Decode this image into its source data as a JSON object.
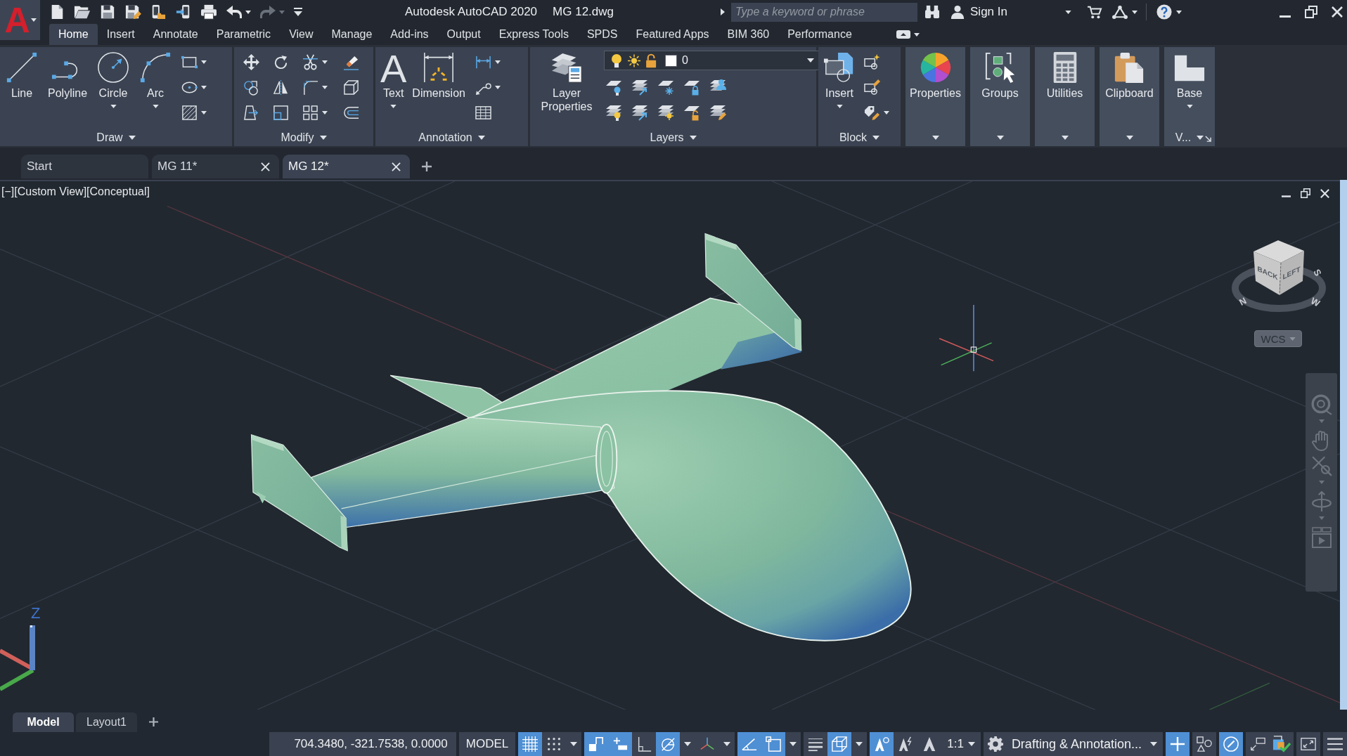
{
  "app_button": {
    "label": "A"
  },
  "quick_access": {
    "redo_disabled": true
  },
  "title": {
    "app": "Autodesk AutoCAD 2020",
    "file": "MG 12.dwg"
  },
  "search": {
    "placeholder": "Type a keyword or phrase"
  },
  "account": {
    "label": "Sign In"
  },
  "ribbon_tabs": [
    {
      "label": "Home",
      "selected": true
    },
    {
      "label": "Insert",
      "selected": false
    },
    {
      "label": "Annotate",
      "selected": false
    },
    {
      "label": "Parametric",
      "selected": false
    },
    {
      "label": "View",
      "selected": false
    },
    {
      "label": "Manage",
      "selected": false
    },
    {
      "label": "Add-ins",
      "selected": false
    },
    {
      "label": "Output",
      "selected": false
    },
    {
      "label": "Express Tools",
      "selected": false
    },
    {
      "label": "SPDS",
      "selected": false
    },
    {
      "label": "Featured Apps",
      "selected": false
    },
    {
      "label": "BIM 360",
      "selected": false
    },
    {
      "label": "Performance",
      "selected": false
    }
  ],
  "ribbon_panels": [
    {
      "kind": "draw",
      "title": "Draw",
      "buttons": [
        {
          "label": "Line"
        },
        {
          "label": "Polyline"
        },
        {
          "label": "Circle"
        },
        {
          "label": "Arc"
        }
      ]
    },
    {
      "kind": "modify",
      "title": "Modify"
    },
    {
      "kind": "annotation",
      "title": "Annotation",
      "buttons": [
        {
          "label": "Text",
          "glyph": "A"
        },
        {
          "label": "Dimension"
        }
      ]
    },
    {
      "kind": "layers",
      "title": "Layers",
      "buttons": [
        {
          "label": "Layer Properties"
        }
      ],
      "current_layer": "0"
    },
    {
      "kind": "block",
      "title": "Block",
      "buttons": [
        {
          "label": "Insert"
        }
      ]
    },
    {
      "kind": "properties",
      "buttons": [
        {
          "label": "Properties"
        }
      ]
    },
    {
      "kind": "groups",
      "buttons": [
        {
          "label": "Groups"
        }
      ]
    },
    {
      "kind": "utilities",
      "buttons": [
        {
          "label": "Utilities"
        }
      ]
    },
    {
      "kind": "clipboard",
      "buttons": [
        {
          "label": "Clipboard"
        }
      ]
    },
    {
      "kind": "view",
      "title": "V...",
      "buttons": [
        {
          "label": "Base"
        }
      ]
    }
  ],
  "document_tabs": [
    {
      "label": "Start",
      "selected": false,
      "closable": false
    },
    {
      "label": "MG 11*",
      "selected": false,
      "closable": true
    },
    {
      "label": "MG 12*",
      "selected": true,
      "closable": true
    }
  ],
  "viewport": {
    "label": "[−][Custom View][Conceptual]",
    "viewcube": {
      "faces": [
        "BACK",
        "LEFT"
      ],
      "compass": [
        "N",
        "W",
        "S"
      ]
    },
    "ucs_button": "WCS",
    "axis_label": "Z"
  },
  "layout_tabs": [
    {
      "label": "Model",
      "selected": true
    },
    {
      "label": "Layout1",
      "selected": false
    }
  ],
  "status_bar": {
    "coordinates": "704.3480, -321.7538, 0.0000",
    "space": "MODEL",
    "toggles": [
      {
        "on": true
      },
      {
        "on": false
      },
      {
        "on": true
      },
      {
        "on": true
      },
      {
        "on": false
      },
      {
        "on": true
      },
      {
        "on": false
      },
      {
        "on": true
      },
      {
        "on": true
      },
      {
        "on": false
      },
      {
        "on": true
      },
      {
        "on": true
      },
      {
        "on": false
      },
      {
        "on": false
      }
    ],
    "annotation_scale": "1:1",
    "workspace": "Drafting & Annotation...",
    "toggles_right": [
      {
        "on": true
      },
      {
        "on": false
      },
      {
        "on": true
      }
    ]
  }
}
